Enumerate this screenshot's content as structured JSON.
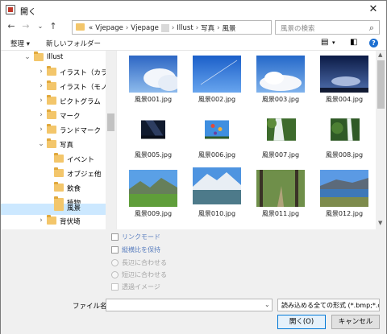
{
  "window": {
    "title": "開く"
  },
  "nav": {
    "back_icon": "arrow-left-icon",
    "forward_icon": "arrow-right-icon",
    "recent_icon": "chevron-down-icon",
    "up_icon": "arrow-up-icon",
    "breadcrumbs": [
      "«",
      "Vjepage",
      "Vjepage",
      "Illust",
      "写真",
      "風景"
    ],
    "search_placeholder": "風景の検索"
  },
  "toolbar": {
    "organize": "整理 ▾",
    "new_folder": "新しいフォルダー"
  },
  "tree": {
    "items": [
      {
        "label": "Illust",
        "expanded": true,
        "level": 0
      },
      {
        "label": "イラスト（カラー）",
        "expanded": false,
        "level": 1
      },
      {
        "label": "イラスト（モノクロ）",
        "expanded": false,
        "level": 1
      },
      {
        "label": "ピクトグラム",
        "expanded": false,
        "level": 1
      },
      {
        "label": "マーク",
        "expanded": false,
        "level": 1
      },
      {
        "label": "ランドマーク",
        "expanded": false,
        "level": 1
      },
      {
        "label": "写真",
        "expanded": true,
        "level": 1
      },
      {
        "label": "イベント",
        "level": 2
      },
      {
        "label": "オブジェ他",
        "level": 2
      },
      {
        "label": "飲食",
        "level": 2
      },
      {
        "label": "植物",
        "level": 2
      },
      {
        "label": "動物",
        "level": 2
      },
      {
        "label": "風景",
        "level": 2,
        "selected": true
      },
      {
        "label": "背伏埼",
        "level": 1
      }
    ]
  },
  "files": [
    {
      "name": "風景001.jpg"
    },
    {
      "name": "風景002.jpg"
    },
    {
      "name": "風景003.jpg"
    },
    {
      "name": "風景004.jpg"
    },
    {
      "name": "風景005.jpg"
    },
    {
      "name": "風景006.jpg"
    },
    {
      "name": "風景007.jpg"
    },
    {
      "name": "風景008.jpg"
    },
    {
      "name": "風景009.jpg"
    },
    {
      "name": "風景010.jpg"
    },
    {
      "name": "風景011.jpg"
    },
    {
      "name": "風景012.jpg"
    }
  ],
  "options": {
    "link_mode": "リンクモード",
    "keep_ratio": "縦横比を保持",
    "fit_long": "長辺に合わせる",
    "fit_short": "短辺に合わせる",
    "transparent": "透過イメージ"
  },
  "footer": {
    "filename_label": "ファイル名(N):",
    "filename_value": "",
    "filter": "読み込める全ての形式 (*.bmp;*.c",
    "open": "開く(O)",
    "cancel": "キャンセル"
  },
  "colors": {
    "selection": "#cce8ff",
    "folder": "#f3c66b",
    "accent": "#0078d7"
  }
}
